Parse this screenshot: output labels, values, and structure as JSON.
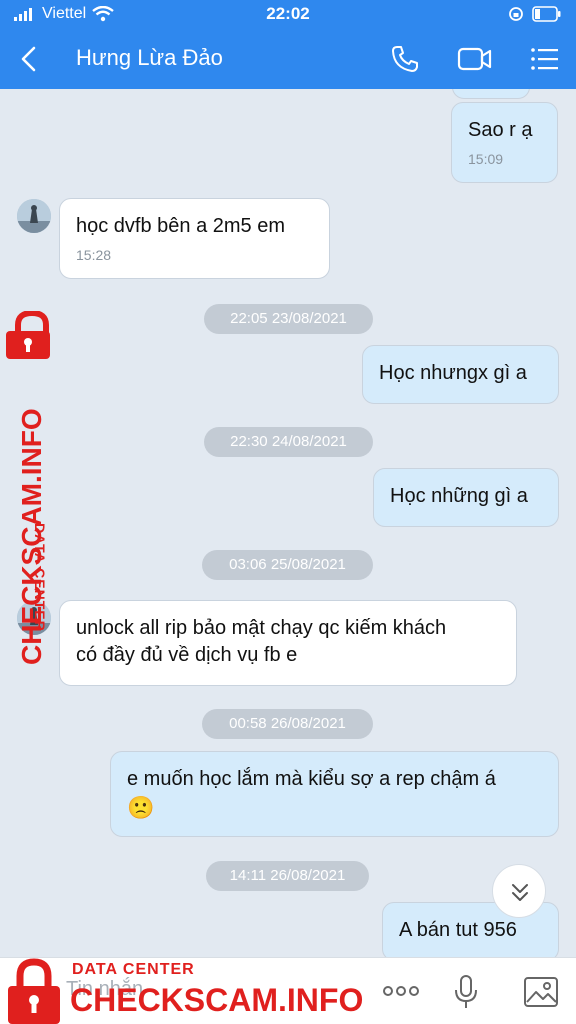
{
  "status": {
    "carrier": "Viettel",
    "time": "22:02"
  },
  "header": {
    "title": "Hưng Lừa Đảo"
  },
  "messages": [
    {
      "text": "Sao r ạ",
      "time": "15:09"
    },
    {
      "text": "học dvfb bên a 2m5 em",
      "time": "15:28"
    },
    {
      "date": "22:05 23/08/2021"
    },
    {
      "text": "Học nhưngx gì a"
    },
    {
      "date": "22:30 24/08/2021"
    },
    {
      "text": "Học những gì a"
    },
    {
      "date": "03:06 25/08/2021"
    },
    {
      "line1": "unlock all rip bảo mật chạy qc kiếm khách",
      "line2": "có đầy đủ về dịch vụ fb e"
    },
    {
      "date": "00:58 26/08/2021"
    },
    {
      "line1": "e muốn học lắm mà kiểu sợ a rep chậm á",
      "emoji": "🙁"
    },
    {
      "date": "14:11 26/08/2021"
    },
    {
      "text": "A bán tut 956"
    }
  ],
  "input": {
    "placeholder": "Tin nhắn"
  },
  "watermark": {
    "side_line1": "DATA CENTER",
    "side_line2": "CHECKSCAM.INFO",
    "bottom_line1": "DATA CENTER",
    "bottom_line2": "CHECKSCAM.INFO"
  },
  "colors": {
    "header": "#2f88ee",
    "background": "#e2e9f1",
    "outgoing": "#d5ebfb",
    "incoming": "#ffffff",
    "watermark": "#e0201e"
  }
}
